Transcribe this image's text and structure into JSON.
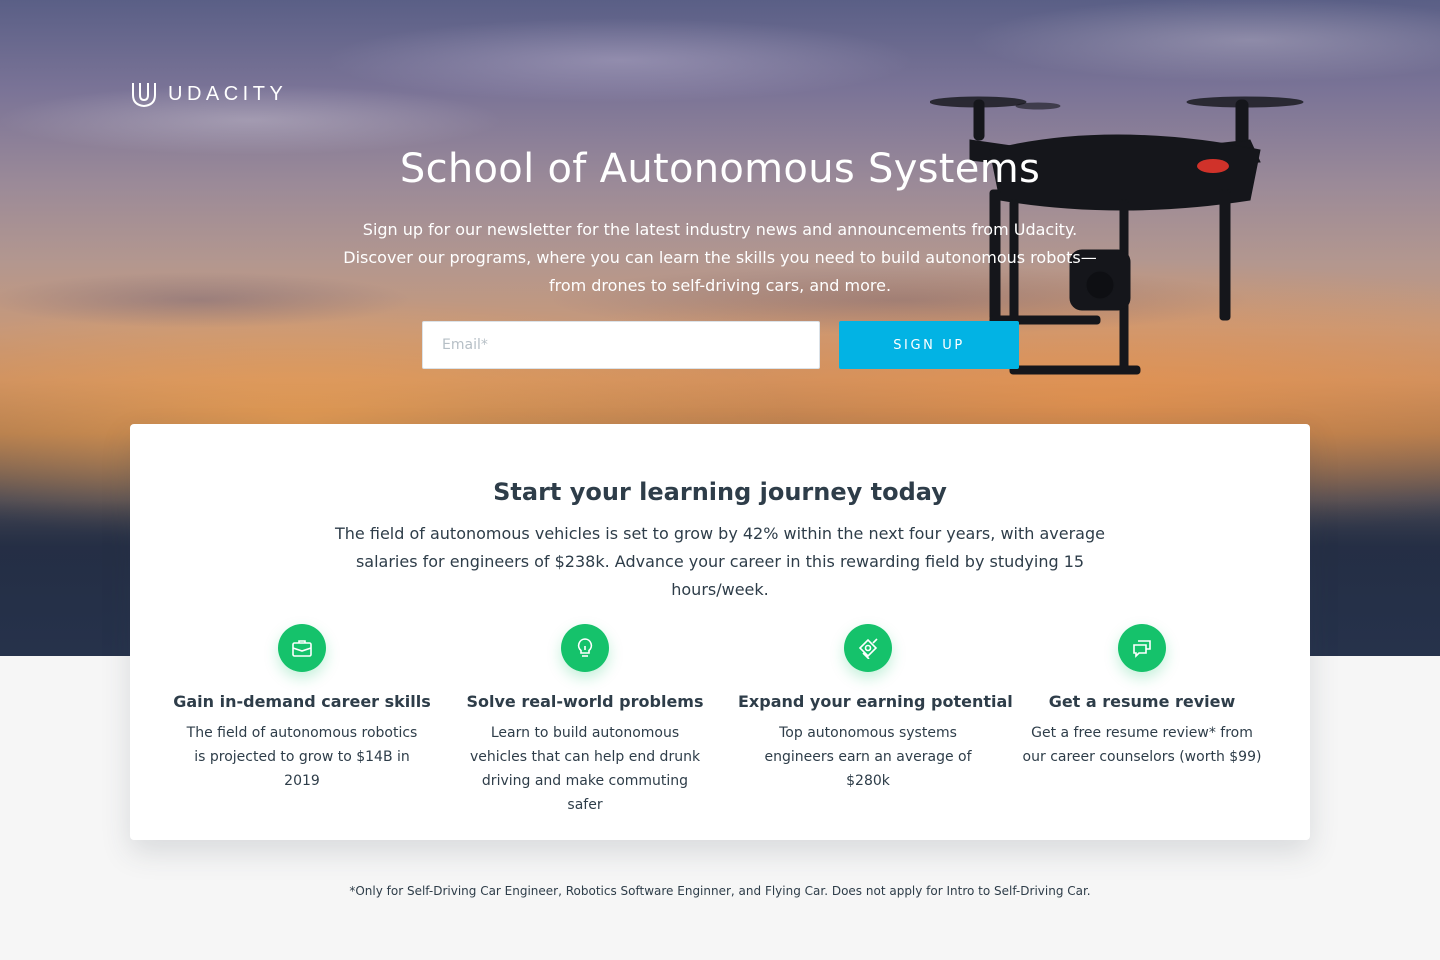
{
  "brand": {
    "logo_text": "UDACITY"
  },
  "hero": {
    "title": "School of Autonomous Systems",
    "description": "Sign up for our newsletter for the latest industry news and announcements from Udacity. Discover our programs, where you can learn the skills you need to build autonomous robots—from drones to self-driving cars, and more.",
    "email_placeholder": "Email*",
    "email_value": "",
    "signup_label": "SIGN UP"
  },
  "card": {
    "title": "Start your learning journey today",
    "description": "The field of autonomous vehicles is set to grow by 42% within the next four years, with average salaries for engineers of $238k. Advance your career in this rewarding field by studying 15 hours/week.",
    "features": [
      {
        "icon": "briefcase-icon",
        "title": "Gain in-demand career skills",
        "description": "The field of autonomous robotics is projected to grow to $14B in 2019"
      },
      {
        "icon": "lightbulb-icon",
        "title": "Solve real-world problems",
        "description": "Learn to build autonomous vehicles that can help end drunk driving and make commuting safer"
      },
      {
        "icon": "money-icon",
        "title": "Expand your earning potential",
        "description": "Top autonomous systems engineers earn an average of $280k"
      },
      {
        "icon": "chat-icon",
        "title": "Get a resume review",
        "description": "Get a free resume review* from our career counselors (worth $99)"
      }
    ]
  },
  "footnote": "*Only for Self-Driving Car Engineer, Robotics Software Enginner, and Flying Car. Does not apply for Intro to Self-Driving Car.",
  "colors": {
    "accent_button": "#02b3e4",
    "feature_icon_bg": "#15c26b",
    "text_primary": "#2e3d49",
    "page_background": "#f6f6f6"
  }
}
